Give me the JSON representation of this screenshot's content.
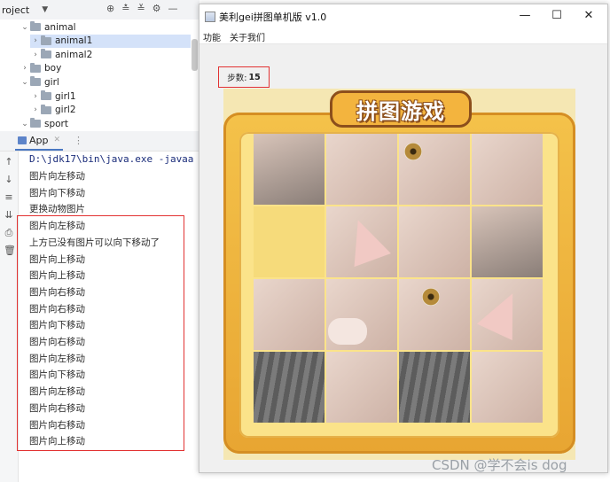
{
  "project": {
    "header_label": "roject",
    "tree": [
      {
        "label": "animal",
        "expanded": true,
        "indent": 1
      },
      {
        "label": "animal1",
        "expanded": false,
        "indent": 2,
        "selected": true
      },
      {
        "label": "animal2",
        "expanded": false,
        "indent": 2
      },
      {
        "label": "boy",
        "expanded": false,
        "indent": 1
      },
      {
        "label": "girl",
        "expanded": true,
        "indent": 1
      },
      {
        "label": "girl1",
        "expanded": false,
        "indent": 2
      },
      {
        "label": "girl2",
        "expanded": false,
        "indent": 2
      },
      {
        "label": "sport",
        "expanded": true,
        "indent": 1
      }
    ]
  },
  "run": {
    "tab_label": "App",
    "command": "D:\\jdk17\\bin\\java.exe -javaa",
    "output": [
      "图片向左移动",
      "图片向下移动",
      "更换动物图片",
      "图片向左移动",
      "上方已没有图片可以向下移动了",
      "图片向上移动",
      "图片向上移动",
      "图片向右移动",
      "图片向右移动",
      "图片向下移动",
      "图片向右移动",
      "图片向左移动",
      "图片向下移动",
      "图片向左移动",
      "图片向右移动",
      "图片向右移动",
      "图片向上移动"
    ]
  },
  "window": {
    "title": "美利gei拼图单机版 v1.0",
    "menu": [
      "功能",
      "关于我们"
    ],
    "step_label": "步数:",
    "step_count": "15",
    "banner": "拼图游戏"
  },
  "puzzle": {
    "rows": 4,
    "cols": 4,
    "empty_tile": {
      "row": 1,
      "col": 0
    }
  },
  "watermark": "CSDN @学不会is dog"
}
